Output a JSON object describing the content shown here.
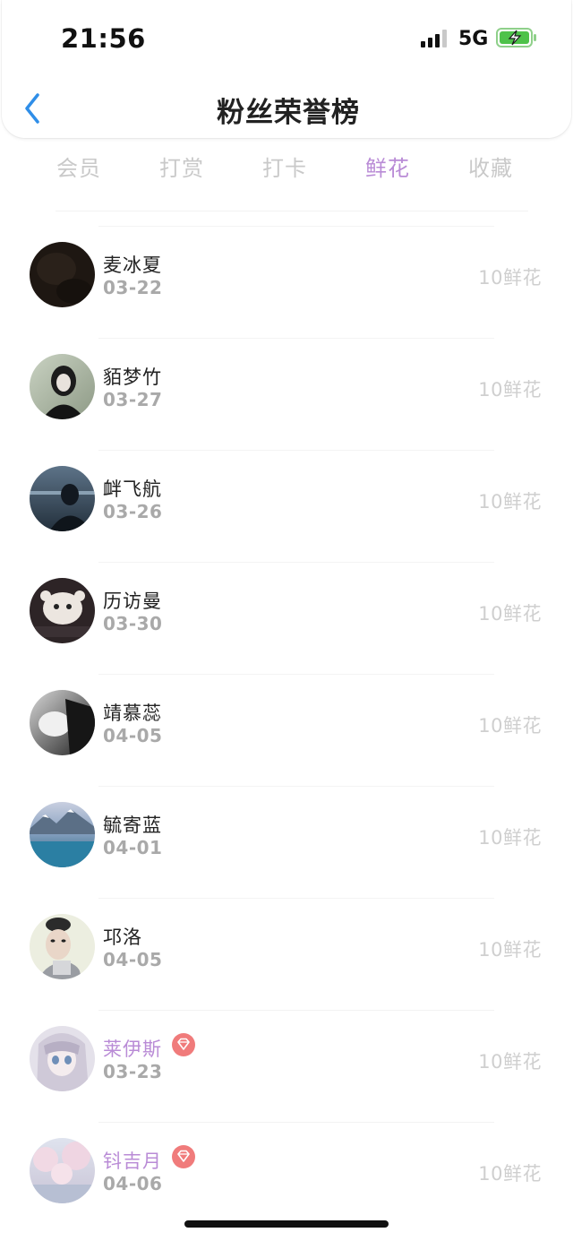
{
  "status_bar": {
    "time": "21:56",
    "network": "5G"
  },
  "header": {
    "title": "粉丝荣誉榜"
  },
  "tabs": [
    {
      "label": "会员",
      "active": false
    },
    {
      "label": "打赏",
      "active": false
    },
    {
      "label": "打卡",
      "active": false
    },
    {
      "label": "鲜花",
      "active": true
    },
    {
      "label": "收藏",
      "active": false
    }
  ],
  "colors": {
    "accent": "#b98bd6",
    "badge": "#f07b7b",
    "muted": "#cfcfcf",
    "date": "#a9a9a9"
  },
  "fans": [
    {
      "name": "麦冰夏",
      "date": "03-22",
      "amount": "10鲜花",
      "vip": false,
      "avatar": "avatar-photo"
    },
    {
      "name": "貊梦竹",
      "date": "03-27",
      "amount": "10鲜花",
      "vip": false,
      "avatar": "avatar-photo"
    },
    {
      "name": "衅飞航",
      "date": "03-26",
      "amount": "10鲜花",
      "vip": false,
      "avatar": "avatar-photo"
    },
    {
      "name": "历访曼",
      "date": "03-30",
      "amount": "10鲜花",
      "vip": false,
      "avatar": "avatar-photo"
    },
    {
      "name": "靖慕蕊",
      "date": "04-05",
      "amount": "10鲜花",
      "vip": false,
      "avatar": "avatar-photo"
    },
    {
      "name": "毓寄蓝",
      "date": "04-01",
      "amount": "10鲜花",
      "vip": false,
      "avatar": "avatar-photo"
    },
    {
      "name": "邛洛",
      "date": "04-05",
      "amount": "10鲜花",
      "vip": false,
      "avatar": "avatar-photo"
    },
    {
      "name": "莱伊斯",
      "date": "03-23",
      "amount": "10鲜花",
      "vip": true,
      "avatar": "avatar-photo"
    },
    {
      "name": "钭吉月",
      "date": "04-06",
      "amount": "10鲜花",
      "vip": true,
      "avatar": "avatar-photo"
    }
  ]
}
